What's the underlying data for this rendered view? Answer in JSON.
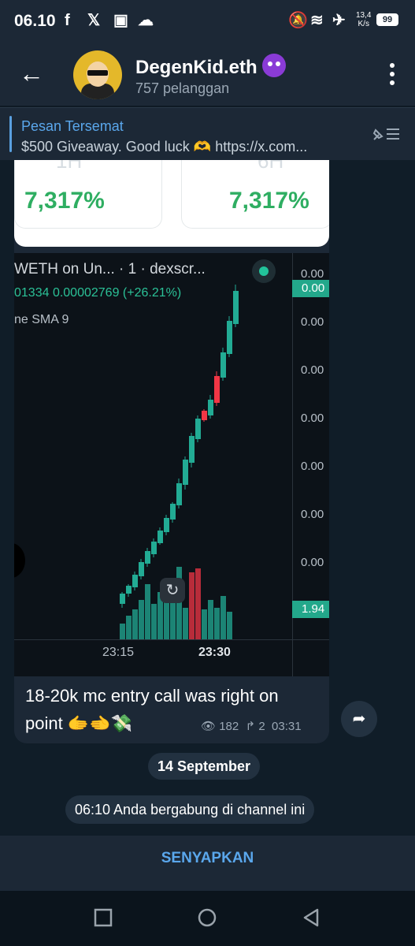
{
  "status_bar": {
    "time": "06.10",
    "speed_value": "13,4",
    "speed_unit": "K/s",
    "battery": "99",
    "icons": [
      "facebook-icon",
      "x-icon",
      "app-icon",
      "cloud-icon",
      "alarm-off-icon",
      "wifi-icon",
      "airplane-icon"
    ]
  },
  "header": {
    "channel_name": "DegenKid.eth",
    "subscribers": "757 pelanggan"
  },
  "pinned": {
    "title": "Pesan Tersemat",
    "text": "$500 Giveaway. Good luck 🫶  https://x.com..."
  },
  "message": {
    "percent_cards": [
      {
        "label": "1H",
        "value": "7,317%"
      },
      {
        "label": "6H",
        "value": "7,317%"
      }
    ],
    "chart": {
      "pair_title": "WETH on Un...  · 1 · dexscr...",
      "price_line": "01334  0.00002769 (+26.21%)",
      "indicator": "ne  SMA 9",
      "y_labels": [
        "0.00",
        "0.00",
        "0.00",
        "0.00",
        "0.00",
        "0.00",
        "0.00"
      ],
      "current_price_tag": "0.00",
      "volume_tag": "1.94",
      "x_labels": [
        "23:15",
        "23:30"
      ],
      "up_color": "#22ab94",
      "down_color": "#f23645"
    },
    "text": "18-20k mc entry call was right on point 🫱‍🫲💸",
    "views": "182",
    "forwards": "2",
    "time": "03:31"
  },
  "date_separator": "14 September",
  "service_message": "06:10 Anda bergabung di channel ini",
  "bottom_action": "SENYAPKAN"
}
